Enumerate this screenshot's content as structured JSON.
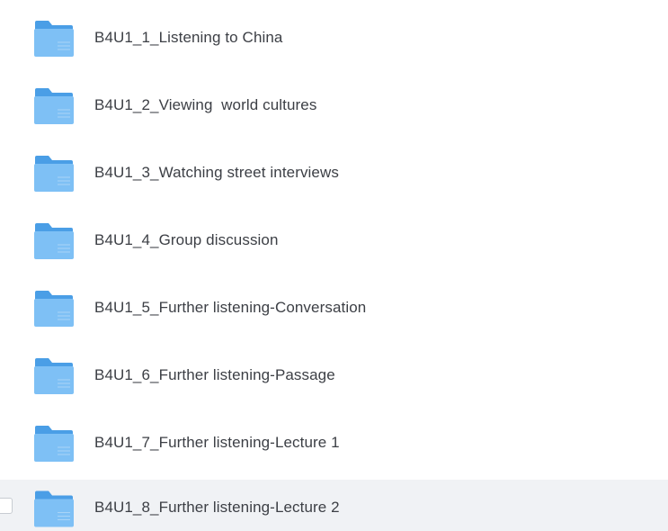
{
  "files": [
    {
      "name": "B4U1_1_Listening to China",
      "icon": "folder-icon"
    },
    {
      "name": "B4U1_2_Viewing  world cultures",
      "icon": "folder-icon"
    },
    {
      "name": "B4U1_3_Watching street interviews",
      "icon": "folder-icon"
    },
    {
      "name": "B4U1_4_Group discussion",
      "icon": "folder-icon"
    },
    {
      "name": "B4U1_5_Further listening-Conversation",
      "icon": "folder-icon"
    },
    {
      "name": "B4U1_6_Further listening-Passage",
      "icon": "folder-icon"
    },
    {
      "name": "B4U1_7_Further listening-Lecture 1",
      "icon": "folder-icon"
    },
    {
      "name": "B4U1_8_Further listening-Lecture 2",
      "icon": "folder-icon",
      "hovered": true
    }
  ],
  "colors": {
    "folder_back": "#4a9ee6",
    "folder_front": "#7ec0f5",
    "folder_lines": "#a9d5f7",
    "text": "#3c3f45",
    "hover_bg": "#f0f2f5"
  }
}
